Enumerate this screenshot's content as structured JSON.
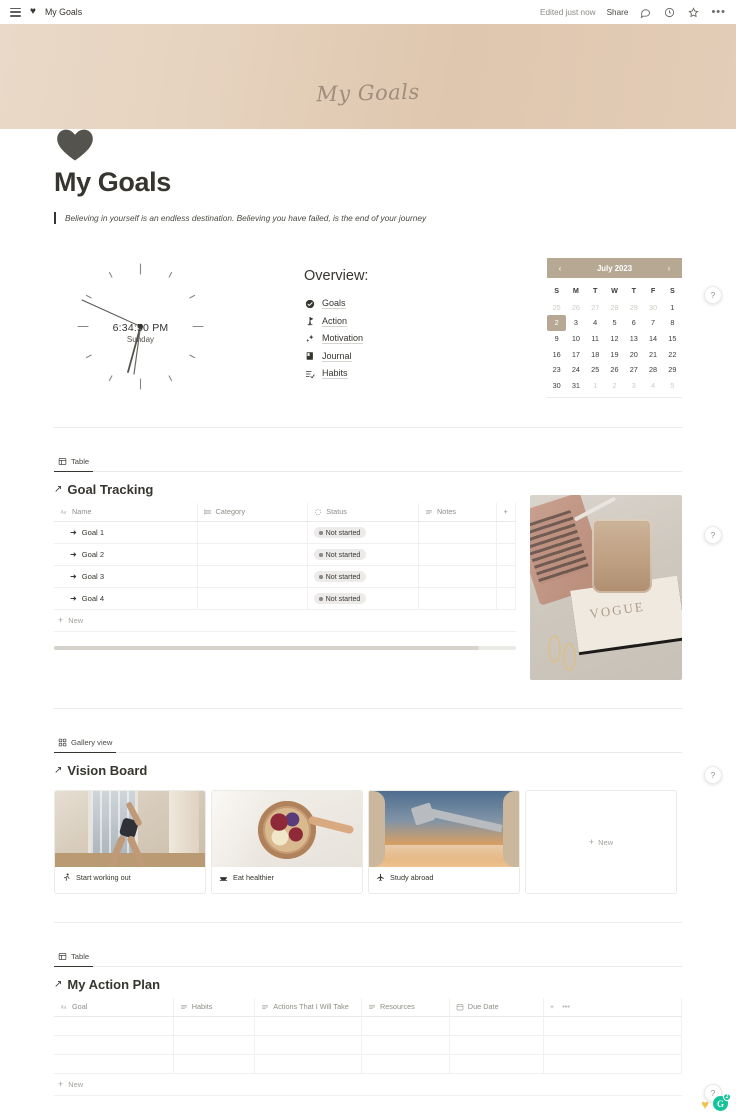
{
  "topbar": {
    "menu_icon": "hamburger-icon",
    "page_icon": "heart-icon",
    "breadcrumb": "My Goals",
    "edited_status": "Edited just now",
    "share_label": "Share",
    "comment_icon": "comment-icon",
    "history_icon": "clock-history-icon",
    "favorite_icon": "star-icon",
    "more_icon": "more-options-icon",
    "more_label": "•••"
  },
  "cover": {
    "title": "My Goals",
    "icon": "heart-icon",
    "color": "#e3cdb8"
  },
  "page": {
    "title": "My Goals",
    "quote": "Believing in yourself is an endless destination. Believing you have failed, is the end of your journey"
  },
  "clock": {
    "time": "6:34:50 PM",
    "day": "Sunday"
  },
  "overview": {
    "heading": "Overview:",
    "items": [
      {
        "label": "Goals",
        "icon": "check-circle-icon"
      },
      {
        "label": "Action",
        "icon": "pin-flag-icon"
      },
      {
        "label": "Motivation",
        "icon": "sparkles-icon"
      },
      {
        "label": "Journal",
        "icon": "book-icon"
      },
      {
        "label": "Habits",
        "icon": "checklist-icon"
      }
    ]
  },
  "calendar": {
    "month_label": "July 2023",
    "prev_icon": "chevron-left-icon",
    "next_icon": "chevron-right-icon",
    "prev_label": "‹",
    "next_label": "›",
    "weekdays": [
      "S",
      "M",
      "T",
      "W",
      "T",
      "F",
      "S"
    ],
    "selected_day": 2,
    "weeks": [
      [
        {
          "d": "25",
          "muted": true
        },
        {
          "d": "26",
          "muted": true
        },
        {
          "d": "27",
          "muted": true
        },
        {
          "d": "28",
          "muted": true
        },
        {
          "d": "29",
          "muted": true
        },
        {
          "d": "30",
          "muted": true
        },
        {
          "d": "1",
          "muted": false
        }
      ],
      [
        {
          "d": "2",
          "muted": false,
          "sel": true
        },
        {
          "d": "3",
          "muted": false
        },
        {
          "d": "4",
          "muted": false
        },
        {
          "d": "5",
          "muted": false
        },
        {
          "d": "6",
          "muted": false
        },
        {
          "d": "7",
          "muted": false
        },
        {
          "d": "8",
          "muted": false
        }
      ],
      [
        {
          "d": "9",
          "muted": false
        },
        {
          "d": "10",
          "muted": false
        },
        {
          "d": "11",
          "muted": false
        },
        {
          "d": "12",
          "muted": false
        },
        {
          "d": "13",
          "muted": false
        },
        {
          "d": "14",
          "muted": false
        },
        {
          "d": "15",
          "muted": false
        }
      ],
      [
        {
          "d": "16",
          "muted": false
        },
        {
          "d": "17",
          "muted": false
        },
        {
          "d": "18",
          "muted": false
        },
        {
          "d": "19",
          "muted": false
        },
        {
          "d": "20",
          "muted": false
        },
        {
          "d": "21",
          "muted": false
        },
        {
          "d": "22",
          "muted": false
        }
      ],
      [
        {
          "d": "23",
          "muted": false
        },
        {
          "d": "24",
          "muted": false
        },
        {
          "d": "25",
          "muted": false
        },
        {
          "d": "26",
          "muted": false
        },
        {
          "d": "27",
          "muted": false
        },
        {
          "d": "28",
          "muted": false
        },
        {
          "d": "29",
          "muted": false
        }
      ],
      [
        {
          "d": "30",
          "muted": false
        },
        {
          "d": "31",
          "muted": false
        },
        {
          "d": "1",
          "muted": true
        },
        {
          "d": "2",
          "muted": true
        },
        {
          "d": "3",
          "muted": true
        },
        {
          "d": "4",
          "muted": true
        },
        {
          "d": "5",
          "muted": true
        }
      ]
    ]
  },
  "goal_tracking": {
    "view_tab": "Table",
    "view_icon": "table-icon",
    "title": "Goal Tracking",
    "title_arrow": "↗",
    "columns": [
      {
        "label": "Name",
        "icon": "title-aa-icon"
      },
      {
        "label": "Category",
        "icon": "multi-select-icon"
      },
      {
        "label": "Status",
        "icon": "status-icon"
      },
      {
        "label": "Notes",
        "icon": "text-icon"
      }
    ],
    "add_column_label": "+",
    "rows": [
      {
        "name": "Goal 1",
        "category": "",
        "status": "Not started",
        "notes": ""
      },
      {
        "name": "Goal 2",
        "category": "",
        "status": "Not started",
        "notes": ""
      },
      {
        "name": "Goal 3",
        "category": "",
        "status": "Not started",
        "notes": ""
      },
      {
        "name": "Goal 4",
        "category": "",
        "status": "Not started",
        "notes": ""
      }
    ],
    "new_row_label": "New",
    "photo": {
      "alt": "iced-coffee-on-books-photo"
    }
  },
  "vision_board": {
    "view_tab": "Gallery view",
    "view_icon": "gallery-icon",
    "title": "Vision Board",
    "title_arrow": "↗",
    "cards": [
      {
        "label": "Start working out",
        "icon": "running-icon",
        "image": "yoga-pose-photo"
      },
      {
        "label": "Eat healthier",
        "icon": "food-bowl-icon",
        "image": "fruit-bowl-photo"
      },
      {
        "label": "Study abroad",
        "icon": "airplane-icon",
        "image": "airplane-wing-photo"
      }
    ],
    "new_card_label": "New"
  },
  "action_plan": {
    "view_tab": "Table",
    "view_icon": "table-icon",
    "title": "My Action Plan",
    "title_arrow": "↗",
    "columns": [
      {
        "label": "Goal",
        "icon": "title-aa-icon"
      },
      {
        "label": "Habits",
        "icon": "text-icon"
      },
      {
        "label": "Actions That I Will Take",
        "icon": "text-icon"
      },
      {
        "label": "Resources",
        "icon": "text-icon"
      },
      {
        "label": "Due Date",
        "icon": "calendar-icon"
      }
    ],
    "add_column_label": "+",
    "more_label": "•••",
    "rows": [
      {
        "goal": "",
        "habits": "",
        "actions": "",
        "resources": "",
        "due_date": ""
      },
      {
        "goal": "",
        "habits": "",
        "actions": "",
        "resources": "",
        "due_date": ""
      },
      {
        "goal": "",
        "habits": "",
        "actions": "",
        "resources": "",
        "due_date": ""
      }
    ],
    "new_row_label": "New"
  },
  "floating": {
    "help_label": "?",
    "gold_heart_icon": "gold-heart-icon",
    "grammarly_letter": "G",
    "grammarly_count": "2"
  }
}
